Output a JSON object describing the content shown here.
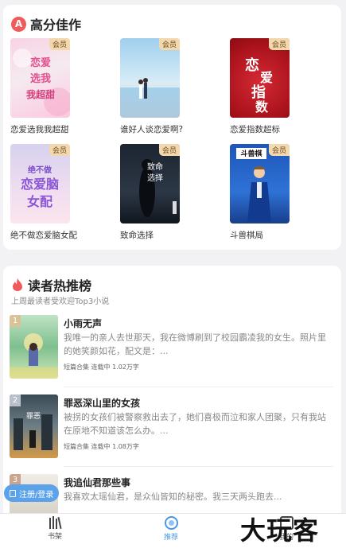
{
  "top_section": {
    "title": "高分佳作",
    "logo_letter": "A",
    "vip_label": "会员",
    "books": [
      {
        "title": "恋爱选我我超甜",
        "cover_text": "恋爱选我\n我超甜"
      },
      {
        "title": "谁好人谈恋爱啊?",
        "cover_text": ""
      },
      {
        "title": "恋爱指数超标",
        "cover_text": "恋爱指数"
      },
      {
        "title": "绝不做恋爱脑女配",
        "cover_text": "恋爱脑女配"
      },
      {
        "title": "致命选择",
        "cover_text": "致命选择"
      },
      {
        "title": "斗兽棋局",
        "cover_text": "斗兽棋"
      }
    ]
  },
  "rank_section": {
    "title": "读者热推榜",
    "subtitle": "上周最读者受欢迎Top3小说",
    "items": [
      {
        "rank": "1",
        "title": "小雨无声",
        "desc": "我唯一的亲人去世那天，我在微博刷到了校园霸凌我的女生。照片里的她笑颜如花，配文是：...",
        "meta": "短篇合集 连载中 1.02万字"
      },
      {
        "rank": "2",
        "title": "罪恶深山里的女孩",
        "desc": "被拐的女孩们被警察救出去了，她们喜极而泣和家人团聚，只有我站在原地不知道该怎么办。...",
        "meta": "短篇合集 连载中 1.08万字"
      },
      {
        "rank": "3",
        "title": "我追仙君那些事",
        "desc": "我喜欢太瑶仙君，是众仙皆知的秘密。我三天两头跑去...",
        "meta": ""
      }
    ]
  },
  "login_button": "注册/登录",
  "tabbar": {
    "tabs": [
      {
        "label": "书架",
        "icon": "bookshelf-icon"
      },
      {
        "label": "推荐",
        "icon": "recommend-icon"
      },
      {
        "label": "我的",
        "icon": "profile-icon"
      }
    ]
  },
  "watermark": "大玩客",
  "colors": {
    "accent": "#4b97e6",
    "flame": "#f05a5a",
    "vip": "#f3d8ad"
  }
}
